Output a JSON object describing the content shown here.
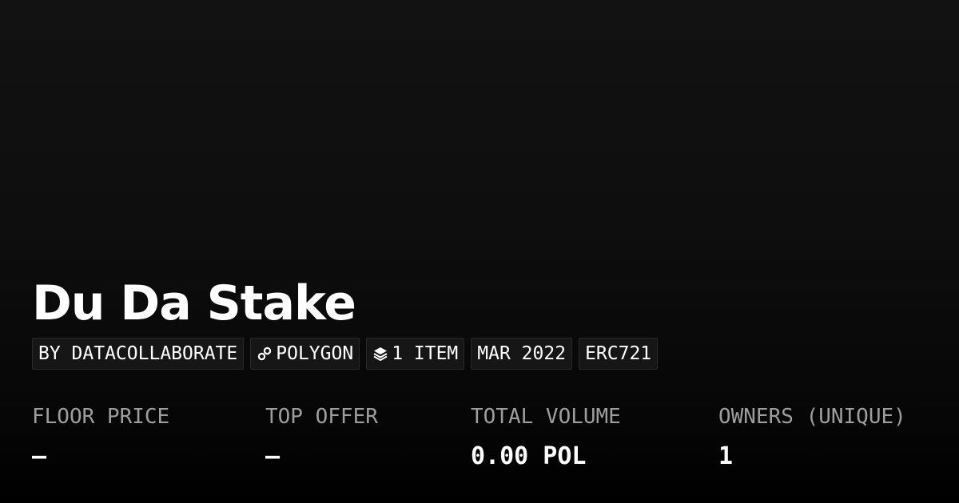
{
  "collection": {
    "title": "Du Da Stake"
  },
  "badges": {
    "creator": "BY DATACOLLABORATE",
    "chain": "POLYGON",
    "chain_icon": "polygon-link-icon",
    "items": "1 ITEM",
    "items_icon": "layers-icon",
    "date": "MAR 2022",
    "standard": "ERC721"
  },
  "stats": {
    "floor_price": {
      "label": "FLOOR PRICE",
      "value": "—"
    },
    "top_offer": {
      "label": "TOP OFFER",
      "value": "—"
    },
    "total_volume": {
      "label": "TOTAL VOLUME",
      "value": "0.00 POL"
    },
    "owners": {
      "label": "OWNERS (UNIQUE)",
      "value": "1"
    }
  },
  "colors": {
    "background_top": "#121212",
    "background_bottom": "#000000",
    "badge_background": "#161616",
    "badge_border": "#2a2a2a",
    "label_gray": "#9e9e9e",
    "text": "#ffffff"
  }
}
